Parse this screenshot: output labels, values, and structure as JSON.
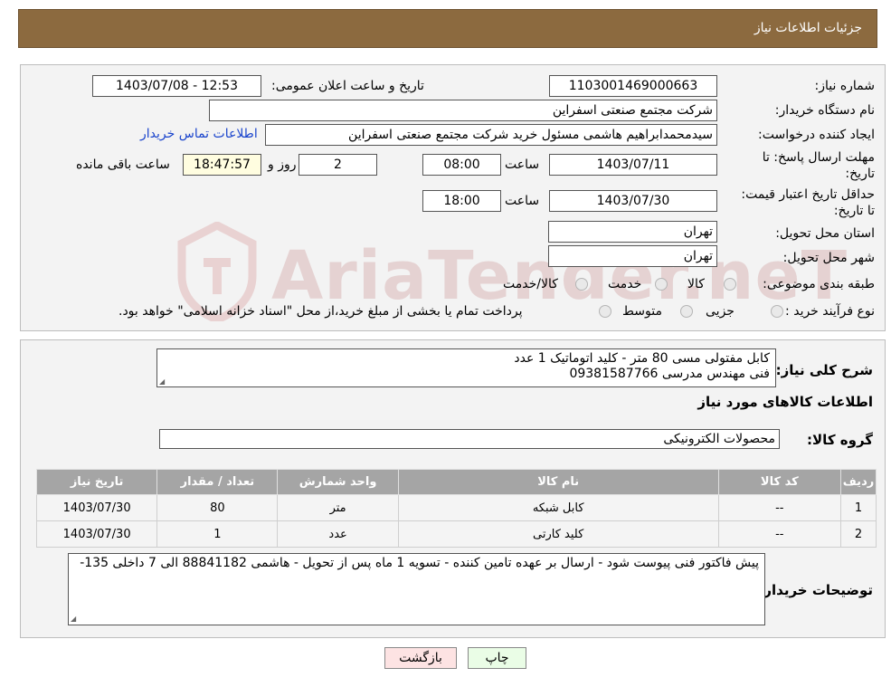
{
  "header": {
    "title": "جزئیات اطلاعات نیاز"
  },
  "form": {
    "need_number_label": "شماره نیاز:",
    "need_number": "1103001469000663",
    "announce_label": "تاریخ و ساعت اعلان عمومی:",
    "announce_value": "1403/07/08 - 12:53",
    "buyer_label": "نام دستگاه خریدار:",
    "buyer_value": "شرکت مجتمع صنعتی اسفراین",
    "creator_label": "ایجاد کننده درخواست:",
    "creator_value": "سیدمحمدابراهیم هاشمی مسئول خرید شرکت مجتمع صنعتی اسفراین",
    "contact_link": "اطلاعات تماس خریدار",
    "deadline_label": "مهلت ارسال پاسخ: تا تاریخ:",
    "deadline_date": "1403/07/11",
    "hour_label": "ساعت",
    "deadline_time": "08:00",
    "days_value": "2",
    "days_label": "روز و",
    "remaining_time": "18:47:57",
    "remaining_label": "ساعت باقی مانده",
    "price_valid_label": "حداقل تاریخ اعتبار قیمت: تا تاریخ:",
    "price_valid_date": "1403/07/30",
    "price_valid_hour_label": "ساعت",
    "price_valid_time": "18:00",
    "province_label": "استان محل تحویل:",
    "province_value": "تهران",
    "city_label": "شهر محل تحویل:",
    "city_value": "تهران",
    "category_label": "طبقه بندی موضوعی:",
    "category_options": [
      "کالا",
      "خدمت",
      "کالا/خدمت"
    ],
    "process_label": "نوع فرآیند خرید :",
    "process_options": [
      "جزیی",
      "متوسط"
    ],
    "process_note": "پرداخت تمام یا بخشی از مبلغ خرید،از محل \"اسناد خزانه اسلامی\" خواهد بود."
  },
  "details": {
    "desc_label": "شرح کلی نیاز:",
    "desc_line1": "کابل مفتولی مسی 80 متر - کلید اتوماتیک 1 عدد",
    "desc_line2": "فنی مهندس مدرسی 09381587766",
    "goods_info_title": "اطلاعات کالاهای مورد نیاز",
    "group_label": "گروه کالا:",
    "group_value": "محصولات الکترونیکی",
    "table": {
      "headers": [
        "ردیف",
        "کد کالا",
        "نام کالا",
        "واحد شمارش",
        "تعداد / مقدار",
        "تاریخ نیاز"
      ],
      "rows": [
        [
          "1",
          "--",
          "کابل شبکه",
          "متر",
          "80",
          "1403/07/30"
        ],
        [
          "2",
          "--",
          "کلید کارتی",
          "عدد",
          "1",
          "1403/07/30"
        ]
      ]
    },
    "buyer_notes_label": "توضیحات خریدار:",
    "buyer_notes": "پیش فاکتور فنی پیوست شود - ارسال بر عهده تامین کننده - تسویه 1 ماه پس از تحویل - هاشمی 88841182 الی 7 داخلی 135-"
  },
  "buttons": {
    "print": "چاپ",
    "back": "بازگشت"
  },
  "watermark": {
    "text": "AriaTender.neT"
  },
  "colors": {
    "header": "#8c6a3f",
    "table_header": "#a5a5a5",
    "link": "#1a44cc",
    "back_button": "#fde3e3",
    "print_button": "#eafde6"
  }
}
